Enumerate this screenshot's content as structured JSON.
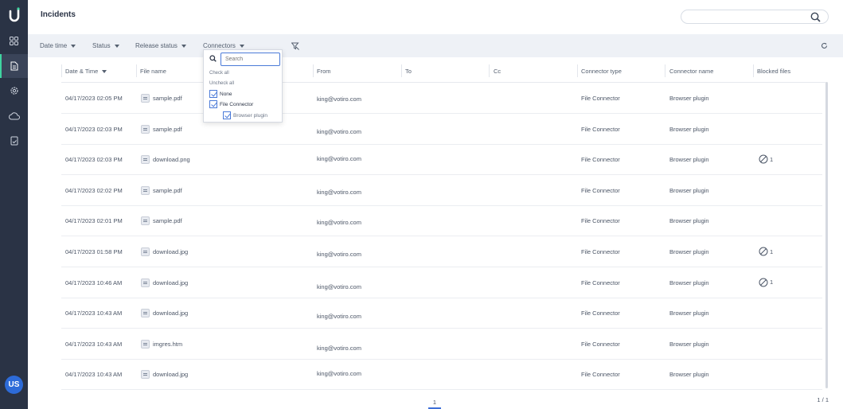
{
  "header": {
    "title": "Incidents",
    "search_placeholder": ""
  },
  "sidebar": {
    "items": [
      {
        "name": "dashboard-icon"
      },
      {
        "name": "incidents-icon",
        "active": true
      },
      {
        "name": "settings-icon"
      },
      {
        "name": "cloud-icon"
      },
      {
        "name": "reports-icon"
      }
    ],
    "avatar": "US"
  },
  "filters": {
    "date_time": "Date time",
    "status": "Status",
    "release_status": "Release status",
    "connectors": "Connectors"
  },
  "columns": {
    "date_time": "Date & Time",
    "file_name": "File name",
    "from": "From",
    "to": "To",
    "cc": "Cc",
    "connector_type": "Connector type",
    "connector_name": "Connector name",
    "blocked_files": "Blocked files"
  },
  "rows": [
    {
      "date": "04/17/2023 02:05 PM",
      "file": "sample.pdf",
      "from": "king@votiro.com",
      "type": "File Connector",
      "name": "Browser plugin",
      "blocked": ""
    },
    {
      "date": "04/17/2023 02:03 PM",
      "file": "sample.pdf",
      "from": "king@votiro.com",
      "type": "File Connector",
      "name": "Browser plugin",
      "blocked": ""
    },
    {
      "date": "04/17/2023 02:03 PM",
      "file": "download.png",
      "from": "king@votiro.com",
      "type": "File Connector",
      "name": "Browser plugin",
      "blocked": "1"
    },
    {
      "date": "04/17/2023 02:02 PM",
      "file": "sample.pdf",
      "from": "king@votiro.com",
      "type": "File Connector",
      "name": "Browser plugin",
      "blocked": ""
    },
    {
      "date": "04/17/2023 02:01 PM",
      "file": "sample.pdf",
      "from": "king@votiro.com",
      "type": "File Connector",
      "name": "Browser plugin",
      "blocked": ""
    },
    {
      "date": "04/17/2023 01:58 PM",
      "file": "download.jpg",
      "from": "king@votiro.com",
      "type": "File Connector",
      "name": "Browser plugin",
      "blocked": "1"
    },
    {
      "date": "04/17/2023 10:46 AM",
      "file": "download.jpg",
      "from": "king@votiro.com",
      "type": "File Connector",
      "name": "Browser plugin",
      "blocked": "1"
    },
    {
      "date": "04/17/2023 10:43 AM",
      "file": "download.jpg",
      "from": "king@votiro.com",
      "type": "File Connector",
      "name": "Browser plugin",
      "blocked": ""
    },
    {
      "date": "04/17/2023 10:43 AM",
      "file": "imgres.htm",
      "from": "king@votiro.com",
      "type": "File Connector",
      "name": "Browser plugin",
      "blocked": ""
    },
    {
      "date": "04/17/2023 10:43 AM",
      "file": "download.jpg",
      "from": "king@votiro.com",
      "type": "File Connector",
      "name": "Browser plugin",
      "blocked": ""
    }
  ],
  "pagination": {
    "current": "1",
    "total": "1 / 1"
  },
  "connectors_dropdown": {
    "search_placeholder": "Search",
    "check_all": "Check all",
    "uncheck_all": "Uncheck all",
    "options": [
      {
        "label": "None",
        "checked": true
      },
      {
        "label": "File Connector",
        "checked": true
      },
      {
        "label": "Browser plugin",
        "checked": true,
        "child": true
      }
    ]
  },
  "colors": {
    "sidebar": "#2a3345",
    "accent": "#3fd4a0",
    "link": "#4a7ad8",
    "filterbar": "#eef1f6"
  }
}
